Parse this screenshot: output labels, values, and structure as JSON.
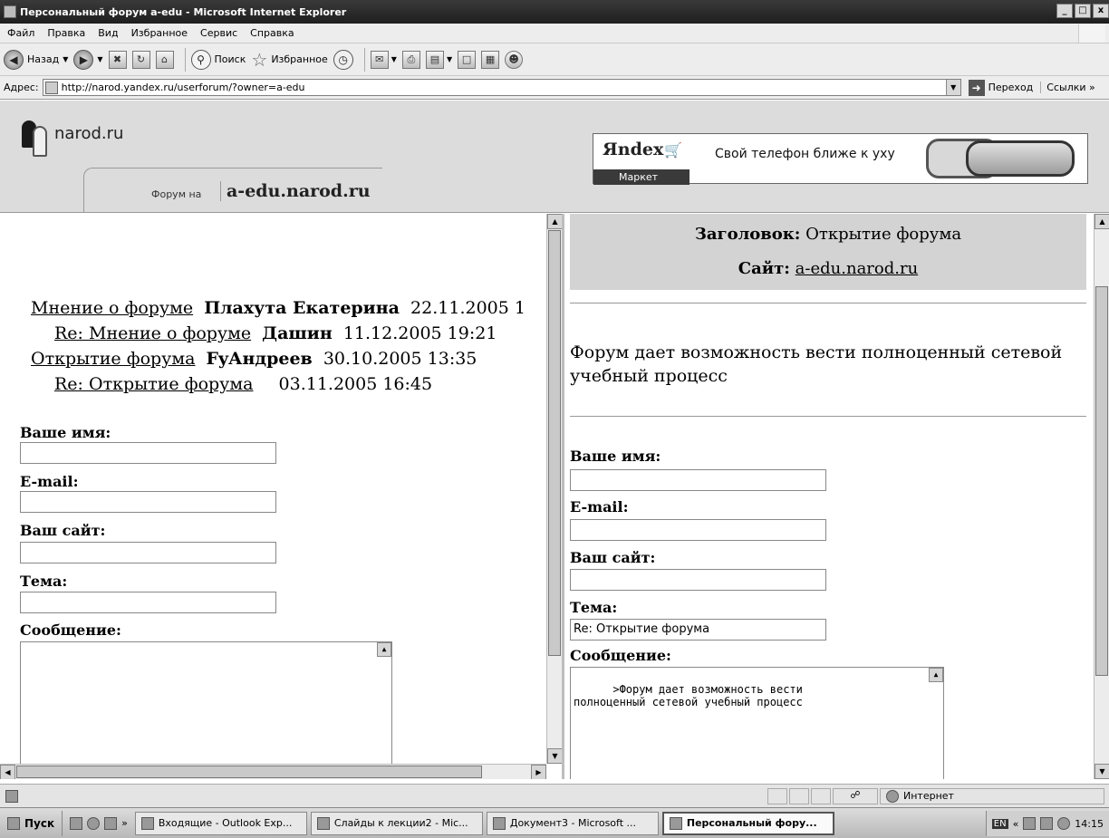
{
  "window": {
    "title": "Персональный форум a-edu - Microsoft Internet Explorer",
    "min": "_",
    "max": "□",
    "close": "x"
  },
  "menu": [
    "Файл",
    "Правка",
    "Вид",
    "Избранное",
    "Сервис",
    "Справка"
  ],
  "toolbar": {
    "back": "Назад",
    "search": "Поиск",
    "favorites": "Избранное"
  },
  "address": {
    "label": "Адрес:",
    "url": "http://narod.yandex.ru/userforum/?owner=a-edu",
    "go": "Переход",
    "links": "Ссылки",
    "more": "»"
  },
  "site": {
    "logo": "narod.ru",
    "forum_label": "Форум на",
    "forum_site": "a-edu.narod.ru"
  },
  "ad": {
    "brand": "Яndex",
    "market": "Маркет",
    "text": "Свой телефон ближе к уху"
  },
  "threads": [
    {
      "title": "Мнение о форуме",
      "author": "Плахута Екатерина",
      "date": "22.11.2005 1",
      "indent": 0
    },
    {
      "title": "Re: Мнение о форуме",
      "author": "Дашин",
      "date": "11.12.2005 19:21",
      "indent": 1
    },
    {
      "title": "Открытие форума",
      "author": "FyАндреев",
      "date": "30.10.2005 13:35",
      "indent": 0
    },
    {
      "title": "Re: Открытие форума",
      "author": "",
      "date": "03.11.2005 16:45",
      "indent": 1
    }
  ],
  "form_left": {
    "name_label": "Ваше имя:",
    "email_label": "E-mail:",
    "site_label": "Ваш сайт:",
    "subject_label": "Тема:",
    "message_label": "Сообщение:",
    "name": "",
    "email": "",
    "site": "",
    "subject": "",
    "message": ""
  },
  "message_view": {
    "subject_label": "Заголовок:",
    "subject": "Открытие форума",
    "site_label": "Сайт:",
    "site": "a-edu.narod.ru",
    "body": "Форум дает возможность вести полноценный сетевой учебный процесс"
  },
  "form_right": {
    "name_label": "Ваше имя:",
    "email_label": "E-mail:",
    "site_label": "Ваш сайт:",
    "subject_label": "Тема:",
    "message_label": "Сообщение:",
    "name": "",
    "email": "",
    "site": "",
    "subject": "Re: Открытие форума",
    "message": ">Форум дает возможность вести\nполноценный сетевой учебный процесс"
  },
  "status": {
    "zone": "Интернет"
  },
  "taskbar": {
    "start": "Пуск",
    "items": [
      "Входящие - Outlook Exp...",
      "Слайды к лекции2 - Mic...",
      "Документ3 - Microsoft ...",
      "Персональный фору..."
    ],
    "lang": "EN",
    "time": "14:15",
    "more": "»",
    "tray_more": "«"
  }
}
